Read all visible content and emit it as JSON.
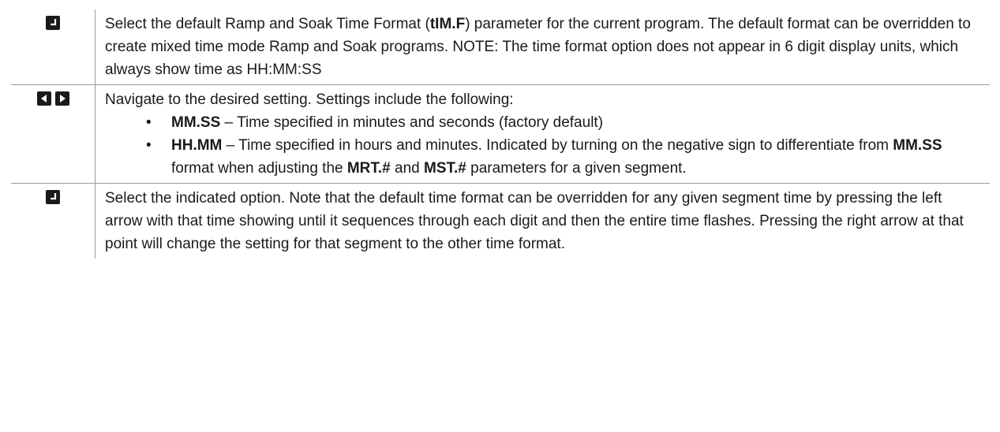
{
  "rows": [
    {
      "icon": "enter-key-icon",
      "segments": [
        {
          "t": "Select the default Ramp and Soak Time Format (",
          "b": false
        },
        {
          "t": "tIM.F",
          "b": true
        },
        {
          "t": ") parameter for the current program. The default format can be overridden to create mixed time mode Ramp and Soak programs. NOTE: The time format  option does not appear in 6 digit display units, which always show time as HH:MM:SS",
          "b": false
        }
      ]
    },
    {
      "icon": "left-right-arrow-keys-icon",
      "intro": "Navigate to the desired setting. Settings include the following:",
      "bullets": [
        [
          {
            "t": "MM.SS",
            "b": true
          },
          {
            "t": "  –  Time specified in minutes and seconds (factory default)",
            "b": false
          }
        ],
        [
          {
            "t": "HH.MM",
            "b": true
          },
          {
            "t": "  –  Time specified in hours and minutes.  Indicated by turning on the negative sign to differentiate from ",
            "b": false
          },
          {
            "t": "MM.SS",
            "b": true
          },
          {
            "t": " format when adjusting the ",
            "b": false
          },
          {
            "t": "MRT.#",
            "b": true
          },
          {
            "t": " and ",
            "b": false
          },
          {
            "t": "MST.#",
            "b": true
          },
          {
            "t": " parameters for a given segment.",
            "b": false
          }
        ]
      ]
    },
    {
      "icon": "enter-key-icon",
      "segments": [
        {
          "t": "Select the indicated option.  Note that the default time format can be overridden for any given segment time by pressing the left arrow with that time showing until it sequences through each digit and then the entire time flashes.  Pressing the right arrow at that point will change the setting for that segment to the other time format.",
          "b": false
        }
      ]
    }
  ]
}
